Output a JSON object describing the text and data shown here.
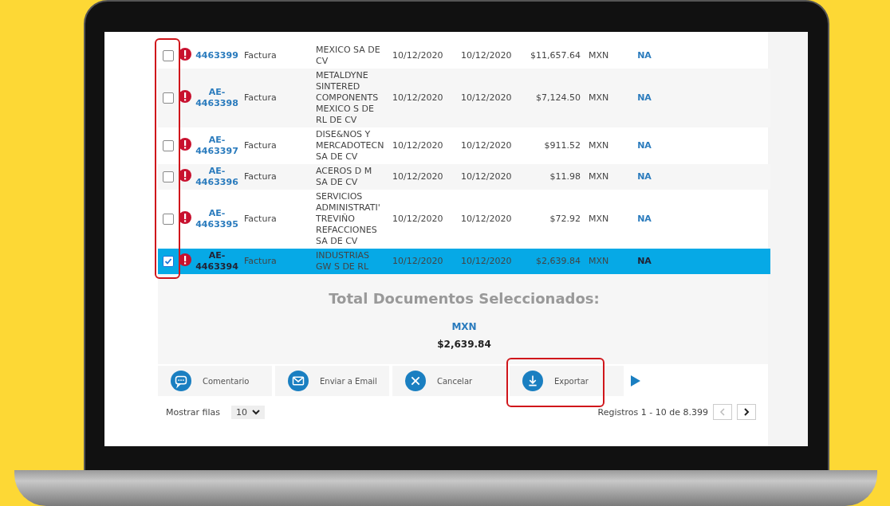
{
  "table": {
    "checkbox_column_highlighted": true,
    "rows": [
      {
        "checked": false,
        "selected": false,
        "alert": true,
        "id": "4463399",
        "type": "Factura",
        "name": "MEXICO SA DE CV",
        "date_1": "10/12/2020",
        "date_2": "10/12/2020",
        "amount": "$11,657.64",
        "currency": "MXN",
        "status": "NA"
      },
      {
        "checked": false,
        "selected": false,
        "alert": true,
        "id": "AE-4463398",
        "type": "Factura",
        "name": "METALDYNE SINTERED COMPONENTS MEXICO S DE RL DE CV",
        "date_1": "10/12/2020",
        "date_2": "10/12/2020",
        "amount": "$7,124.50",
        "currency": "MXN",
        "status": "NA"
      },
      {
        "checked": false,
        "selected": false,
        "alert": true,
        "id": "AE-4463397",
        "type": "Factura",
        "name": "DISE&NOS Y MERCADOTECN SA DE CV",
        "date_1": "10/12/2020",
        "date_2": "10/12/2020",
        "amount": "$911.52",
        "currency": "MXN",
        "status": "NA"
      },
      {
        "checked": false,
        "selected": false,
        "alert": true,
        "id": "AE-4463396",
        "type": "Factura",
        "name": "ACEROS D M SA DE CV",
        "date_1": "10/12/2020",
        "date_2": "10/12/2020",
        "amount": "$11.98",
        "currency": "MXN",
        "status": "NA"
      },
      {
        "checked": false,
        "selected": false,
        "alert": true,
        "id": "AE-4463395",
        "type": "Factura",
        "name": "SERVICIOS ADMINISTRATI' TREVIÑO REFACCIONES SA DE CV",
        "date_1": "10/12/2020",
        "date_2": "10/12/2020",
        "amount": "$72.92",
        "currency": "MXN",
        "status": "NA"
      },
      {
        "checked": true,
        "selected": true,
        "alert": true,
        "id": "AE-4463394",
        "type": "Factura",
        "name": "INDUSTRIAS GW S DE RL",
        "date_1": "10/12/2020",
        "date_2": "10/12/2020",
        "amount": "$2,639.84",
        "currency": "MXN",
        "status": "NA"
      }
    ]
  },
  "totals": {
    "title": "Total Documentos Seleccionados:",
    "currency": "MXN",
    "amount": "$2,639.84"
  },
  "actions": [
    {
      "kind": "comment",
      "label": "Comentario",
      "highlighted": false
    },
    {
      "kind": "email",
      "label": "Enviar a Email",
      "highlighted": false
    },
    {
      "kind": "cancel",
      "label": "Cancelar",
      "highlighted": false
    },
    {
      "kind": "export",
      "label": "Exportar",
      "highlighted": true
    }
  ],
  "footer": {
    "rows_label": "Mostrar filas",
    "rows_value": "10",
    "records": "Registros 1 - 10 de 8.399",
    "prev_disabled": true
  }
}
